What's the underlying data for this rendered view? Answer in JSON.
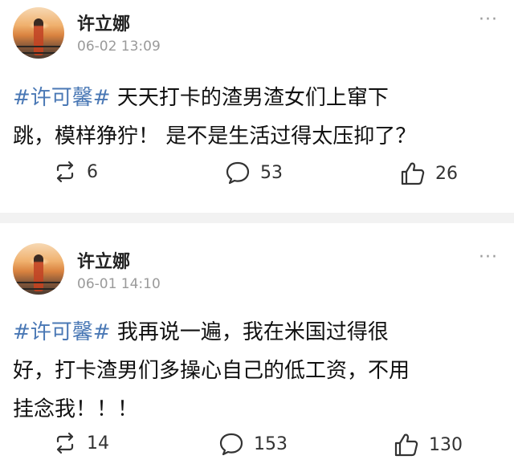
{
  "posts": [
    {
      "author": "许立娜",
      "time": "06-02 13:09",
      "hashtag": "#许可馨#",
      "line1_rest": " 天天打卡的渣男渣女们上窜下",
      "lines": [
        "跳，模样狰狞！ 是不是生活过得太压抑了？"
      ],
      "repost_count": "6",
      "comment_count": "53",
      "like_count": "26",
      "more_label": "···"
    },
    {
      "author": "许立娜",
      "time": "06-01 14:10",
      "hashtag": "#许可馨#",
      "line1_rest": " 我再说一遍，我在米国过得很",
      "lines": [
        "好，打卡渣男们多操心自己的低工资，不用",
        "挂念我！！！"
      ],
      "repost_count": "14",
      "comment_count": "153",
      "like_count": "130",
      "more_label": "···"
    }
  ],
  "colors": {
    "hashtag": "#4a78b5",
    "muted": "#9a9a9a",
    "divider": "#f2f2f2"
  },
  "icons": {
    "repost": "repost-icon",
    "comment": "comment-icon",
    "like": "thumbs-up-icon",
    "more": "more-dots-icon"
  }
}
